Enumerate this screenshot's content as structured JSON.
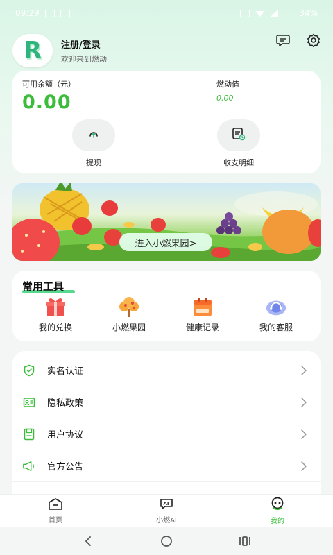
{
  "status_bar": {
    "time": "09:29",
    "battery": "34%"
  },
  "profile": {
    "name": "注册/登录",
    "subtitle": "欢迎来到燃动",
    "avatar_logo": "R"
  },
  "balance": {
    "label": "可用余额（元）",
    "value": "0.00",
    "points_label": "燃动值",
    "points_value": "0.00",
    "actions": [
      {
        "label": "提现",
        "icon": "withdraw-icon"
      },
      {
        "label": "收支明细",
        "icon": "statement-icon"
      }
    ]
  },
  "banner": {
    "button_label": "进入小燃果园>"
  },
  "tools": {
    "title": "常用工具",
    "items": [
      {
        "label": "我的兑换",
        "icon": "gift-icon"
      },
      {
        "label": "小燃果园",
        "icon": "tree-icon"
      },
      {
        "label": "健康记录",
        "icon": "calendar-icon"
      },
      {
        "label": "我的客服",
        "icon": "headset-icon"
      }
    ]
  },
  "menu": {
    "items": [
      {
        "label": "实名认证",
        "icon": "shield-icon"
      },
      {
        "label": "隐私政策",
        "icon": "id-card-icon"
      },
      {
        "label": "用户协议",
        "icon": "document-icon"
      },
      {
        "label": "官方公告",
        "icon": "megaphone-icon"
      }
    ]
  },
  "tabbar": {
    "items": [
      {
        "label": "首页",
        "icon": "home-icon"
      },
      {
        "label": "小燃AI",
        "icon": "ai-icon"
      },
      {
        "label": "我的",
        "icon": "profile-icon",
        "active": true
      }
    ]
  },
  "colors": {
    "accent_green": "#3bbd3b",
    "background_tint": "#d9f5e6"
  }
}
